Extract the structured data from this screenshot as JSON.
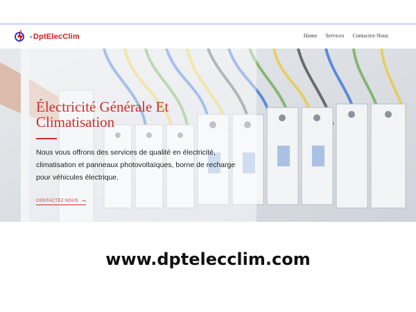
{
  "brand": {
    "logo_prefix": "-",
    "logo_text": "DptElecClim",
    "logo_colors": {
      "text": "#d11f1f",
      "accent": "#2a3bd6"
    }
  },
  "nav": {
    "items": [
      {
        "label": "Home"
      },
      {
        "label": "Services"
      },
      {
        "label": "Contactez-Nous"
      }
    ]
  },
  "hero": {
    "title": "Électricité Générale Et Climatisation",
    "description": "Nous vous offrons des services de qualité en électricité, climatisation et panneaux photovoltaïques, borne de recharge pour véhicules électrique.",
    "cta_label": "CONTACTEZ NOUS",
    "cta_icon": "arrow-right-icon",
    "accent_color": "#c9302c"
  },
  "footer": {
    "url_text": "www.dptelecclim.com"
  }
}
